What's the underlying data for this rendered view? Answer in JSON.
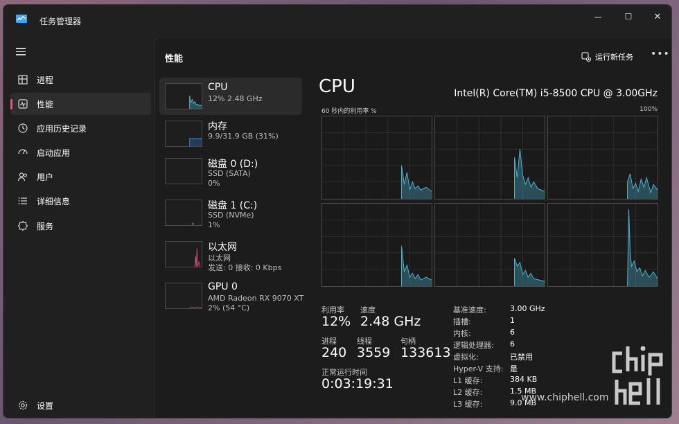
{
  "app": {
    "title": "任务管理器"
  },
  "window_controls": {
    "minimize": "—",
    "maximize": "☐",
    "close": "✕"
  },
  "sidebar": {
    "items": [
      {
        "label": "进程",
        "icon": "processes-icon"
      },
      {
        "label": "性能",
        "icon": "performance-icon",
        "active": true
      },
      {
        "label": "应用历史记录",
        "icon": "history-icon"
      },
      {
        "label": "启动应用",
        "icon": "startup-icon"
      },
      {
        "label": "用户",
        "icon": "users-icon"
      },
      {
        "label": "详细信息",
        "icon": "details-icon"
      },
      {
        "label": "服务",
        "icon": "services-icon"
      }
    ],
    "settings_label": "设置"
  },
  "header": {
    "title": "性能",
    "run_task_label": "运行新任务",
    "more_label": "•••"
  },
  "resources": [
    {
      "name": "CPU",
      "sub1": "12% 2.48 GHz",
      "sub2": ""
    },
    {
      "name": "内存",
      "sub1": "9.9/31.9 GB (31%)",
      "sub2": ""
    },
    {
      "name": "磁盘 0 (D:)",
      "sub1": "SSD (SATA)",
      "sub2": "0%"
    },
    {
      "name": "磁盘 1 (C:)",
      "sub1": "SSD (NVMe)",
      "sub2": "1%"
    },
    {
      "name": "以太网",
      "sub1": "以太网",
      "sub2": "发送: 0 接收: 0 Kbps"
    },
    {
      "name": "GPU 0",
      "sub1": "AMD Radeon RX 9070 XT",
      "sub2": "2% (54 °C)"
    }
  ],
  "detail": {
    "title": "CPU",
    "model": "Intel(R) Core(TM) i5-8500 CPU @ 3.00GHz",
    "graph_label": "60 秒内的利用率 %",
    "graph_max": "100%",
    "stats": {
      "util_label": "利用率",
      "util_value": "12%",
      "speed_label": "速度",
      "speed_value": "2.48 GHz",
      "proc_label": "进程",
      "proc_value": "240",
      "thread_label": "线程",
      "thread_value": "3559",
      "handle_label": "句柄",
      "handle_value": "133613",
      "uptime_label": "正常运行时间",
      "uptime_value": "0:03:19:31"
    },
    "specs": [
      {
        "k": "基准速度:",
        "v": "3.00 GHz"
      },
      {
        "k": "插槽:",
        "v": "1"
      },
      {
        "k": "内核:",
        "v": "6"
      },
      {
        "k": "逻辑处理器:",
        "v": "6"
      },
      {
        "k": "虚拟化:",
        "v": "已禁用"
      },
      {
        "k": "Hyper-V 支持:",
        "v": "是"
      },
      {
        "k": "L1 缓存:",
        "v": "384 KB"
      },
      {
        "k": "L2 缓存:",
        "v": "1.5 MB"
      },
      {
        "k": "L3 缓存:",
        "v": "9.0 MB"
      }
    ]
  },
  "watermark": {
    "url": "www.chiphell.com"
  },
  "colors": {
    "accent": "#e0588a",
    "cpu_graph": "#4fb3cf",
    "mem_graph": "#3d6fbf",
    "eth_graph": "#c2507a",
    "gpu_graph": "#a04a70"
  }
}
